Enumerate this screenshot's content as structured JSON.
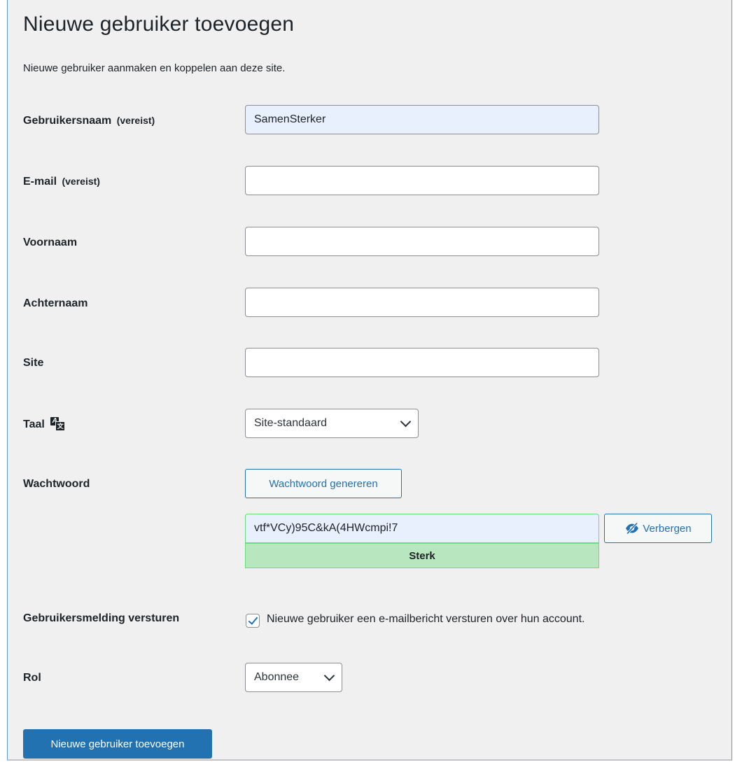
{
  "page": {
    "title": "Nieuwe gebruiker toevoegen",
    "intro": "Nieuwe gebruiker aanmaken en koppelen aan deze site."
  },
  "form": {
    "username": {
      "label": "Gebruikersnaam",
      "required": "(vereist)",
      "value": "SamenSterker"
    },
    "email": {
      "label": "E-mail",
      "required": "(vereist)",
      "value": ""
    },
    "first_name": {
      "label": "Voornaam",
      "value": ""
    },
    "last_name": {
      "label": "Achternaam",
      "value": ""
    },
    "website": {
      "label": "Site",
      "value": ""
    },
    "language": {
      "label": "Taal",
      "icon": "translation-icon",
      "selected": "Site-standaard"
    },
    "password": {
      "label": "Wachtwoord",
      "generate_label": "Wachtwoord genereren",
      "value": "vtf*VCy)95C&kA(4HWcmpi!7",
      "strength": "Sterk",
      "hide_label": "Verbergen",
      "hide_icon": "eye-slash-icon"
    },
    "notify": {
      "label": "Gebruikersmelding versturen",
      "checked": true,
      "text": "Nieuwe gebruiker een e-mailbericht versturen over hun account."
    },
    "role": {
      "label": "Rol",
      "selected": "Abonnee"
    },
    "submit_label": "Nieuwe gebruiker toevoegen"
  },
  "colors": {
    "accent": "#2271b1",
    "background": "#f0f0f1",
    "autofill": "#e8f0fe",
    "strong": "#b8e6bf",
    "strong_border": "#68de7c"
  }
}
